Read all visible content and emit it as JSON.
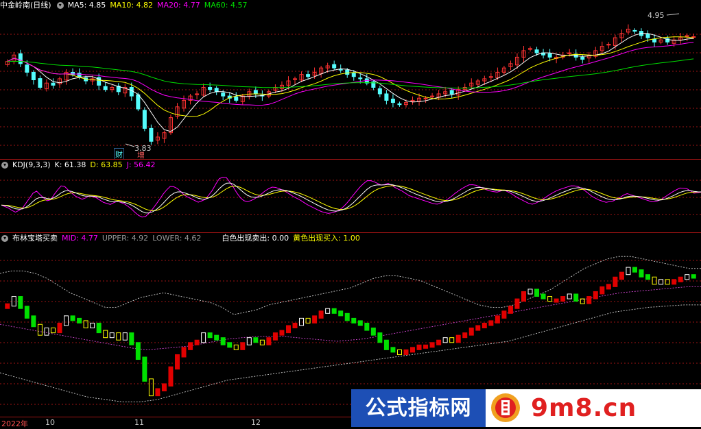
{
  "main_pane": {
    "title": "中金岭南(日线)",
    "ma5": "MA5: 4.85",
    "ma10": "MA10: 4.82",
    "ma20": "MA20: 4.77",
    "ma60": "MA60: 4.57",
    "high_label": "4.95",
    "low_label": "3.83",
    "tag_cai": "财",
    "tag_zeng": "增"
  },
  "kdj_pane": {
    "title": "KDJ(9,3,3)",
    "k": "K: 61.38",
    "d": "D: 63.85",
    "j": "J: 56.42"
  },
  "boll_pane": {
    "title": "布林宝塔买卖",
    "mid": "MID: 4.77",
    "upper": "UPPER: 4.92",
    "lower": "LOWER: 4.62",
    "white_sell": "白色出现卖出: 0.00",
    "yellow_buy": "黄色出现买入: 1.00"
  },
  "time_axis": {
    "year": "2022年",
    "m10": "10",
    "m11": "11",
    "m12": "12"
  },
  "watermark": {
    "left_text": "公式指标网",
    "right_text": "9m8.cn"
  },
  "colors": {
    "up": "#ff3232",
    "down": "#54fcfc",
    "ma5": "#ffffff",
    "ma10": "#ffff00",
    "ma20": "#ff00ff",
    "ma60": "#00e000",
    "grid": "#a01414",
    "tower_up": "#e00000",
    "tower_down": "#00e000"
  },
  "chart_data": {
    "type": "candlestick",
    "closes": [
      4.62,
      4.68,
      4.6,
      4.52,
      4.45,
      4.38,
      4.42,
      4.4,
      4.46,
      4.52,
      4.5,
      4.48,
      4.44,
      4.46,
      4.4,
      4.36,
      4.38,
      4.34,
      4.38,
      4.3,
      4.18,
      4.0,
      3.88,
      3.92,
      3.96,
      4.1,
      4.2,
      4.26,
      4.3,
      4.32,
      4.38,
      4.36,
      4.34,
      4.3,
      4.28,
      4.26,
      4.3,
      4.34,
      4.32,
      4.3,
      4.34,
      4.38,
      4.4,
      4.44,
      4.46,
      4.5,
      4.48,
      4.52,
      4.56,
      4.58,
      4.56,
      4.54,
      4.5,
      4.48,
      4.46,
      4.42,
      4.38,
      4.32,
      4.26,
      4.24,
      4.22,
      4.24,
      4.26,
      4.28,
      4.28,
      4.3,
      4.32,
      4.34,
      4.32,
      4.36,
      4.38,
      4.42,
      4.44,
      4.46,
      4.48,
      4.52,
      4.56,
      4.6,
      4.66,
      4.72,
      4.74,
      4.7,
      4.68,
      4.66,
      4.66,
      4.68,
      4.7,
      4.66,
      4.64,
      4.68,
      4.72,
      4.76,
      4.78,
      4.84,
      4.88,
      4.92,
      4.9,
      4.86,
      4.84,
      4.8,
      4.82,
      4.8,
      4.82,
      4.84,
      4.86,
      4.85
    ],
    "kdj_j": [
      35,
      30,
      22,
      28,
      45,
      62,
      50,
      40,
      58,
      72,
      60,
      50,
      45,
      52,
      48,
      40,
      36,
      42,
      38,
      30,
      18,
      12,
      24,
      40,
      58,
      70,
      64,
      52,
      46,
      40,
      45,
      60,
      82,
      86,
      70,
      50,
      40,
      44,
      52,
      62,
      68,
      64,
      58,
      50,
      44,
      36,
      30,
      24,
      20,
      22,
      28,
      40,
      56,
      70,
      80,
      76,
      70,
      74,
      66,
      60,
      52,
      48,
      44,
      40,
      36,
      40,
      48,
      58,
      66,
      72,
      70,
      64,
      60,
      58,
      62,
      56,
      48,
      42,
      36,
      40,
      48,
      56,
      62,
      66,
      70,
      68,
      60,
      50,
      44,
      40,
      42,
      48,
      56,
      52,
      48,
      44,
      40,
      44,
      52,
      60,
      66,
      64,
      56,
      58
    ],
    "boll_upper": [
      4.88,
      4.9,
      4.9,
      4.88,
      4.84,
      4.78,
      4.72,
      4.68,
      4.64,
      4.6,
      4.6,
      4.64,
      4.68,
      4.7,
      4.72,
      4.7,
      4.68,
      4.66,
      4.64,
      4.6,
      4.54,
      4.56,
      4.58,
      4.62,
      4.64,
      4.66,
      4.68,
      4.7,
      4.72,
      4.74,
      4.76,
      4.8,
      4.84,
      4.86,
      4.86,
      4.84,
      4.82,
      4.78,
      4.74,
      4.7,
      4.66,
      4.62,
      4.6,
      4.6,
      4.62,
      4.66,
      4.7,
      4.74,
      4.8,
      4.86,
      4.92,
      4.96,
      5.0,
      5.02,
      5.02,
      5.0,
      4.98,
      4.96,
      4.94,
      4.92,
      4.92
    ],
    "boll_mid": [
      4.46,
      4.44,
      4.42,
      4.4,
      4.38,
      4.36,
      4.34,
      4.32,
      4.3,
      4.28,
      4.26,
      4.25,
      4.26,
      4.27,
      4.28,
      4.3,
      4.32,
      4.34,
      4.35,
      4.36,
      4.36,
      4.36,
      4.35,
      4.34,
      4.33,
      4.32,
      4.33,
      4.34,
      4.36,
      4.38,
      4.4,
      4.42,
      4.44,
      4.46,
      4.48,
      4.5,
      4.52,
      4.54,
      4.56,
      4.58,
      4.6,
      4.62,
      4.64,
      4.66,
      4.68,
      4.7,
      4.72,
      4.73,
      4.74,
      4.75,
      4.76,
      4.77,
      4.77
    ],
    "boll_lower": [
      4.06,
      4.02,
      3.98,
      3.94,
      3.9,
      3.86,
      3.84,
      3.82,
      3.82,
      3.84,
      3.88,
      3.92,
      3.96,
      4.0,
      4.02,
      4.04,
      4.06,
      4.08,
      4.1,
      4.12,
      4.14,
      4.16,
      4.18,
      4.2,
      4.22,
      4.24,
      4.26,
      4.28,
      4.3,
      4.32,
      4.36,
      4.4,
      4.44,
      4.48,
      4.52,
      4.56,
      4.58,
      4.6,
      4.61,
      4.62,
      4.62
    ]
  }
}
